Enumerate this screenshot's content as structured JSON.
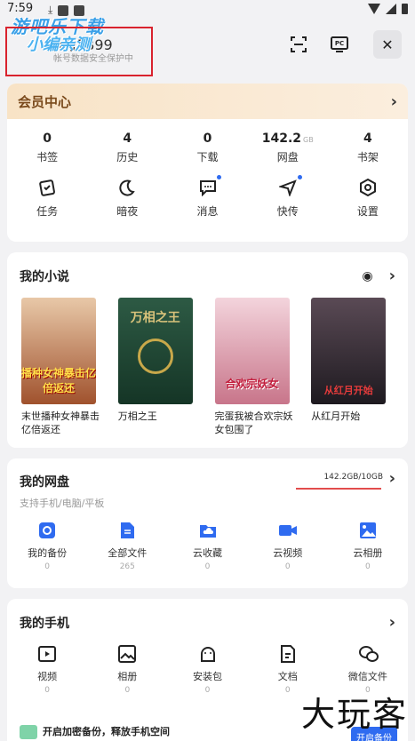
{
  "status": {
    "time": "7:59"
  },
  "header": {
    "watermark_line1": "游吧乐下载",
    "watermark_line2": "小编亲测",
    "username": "华为3899",
    "subtitle": "帐号数据安全保护中",
    "scan_icon": "scan-icon",
    "pc_label": "PC",
    "close_icon": "close-icon"
  },
  "vip": {
    "title": "会员中心",
    "stats": [
      {
        "num": "0",
        "unit": "",
        "label": "书签"
      },
      {
        "num": "4",
        "unit": "",
        "label": "历史"
      },
      {
        "num": "0",
        "unit": "",
        "label": "下载"
      },
      {
        "num": "142.2",
        "unit": "GB",
        "label": "网盘"
      },
      {
        "num": "4",
        "unit": "",
        "label": "书架"
      }
    ],
    "tools": [
      {
        "label": "任务",
        "icon": "task-icon"
      },
      {
        "label": "暗夜",
        "icon": "moon-icon"
      },
      {
        "label": "消息",
        "icon": "message-icon"
      },
      {
        "label": "快传",
        "icon": "send-icon"
      },
      {
        "label": "设置",
        "icon": "settings-icon"
      }
    ]
  },
  "novel": {
    "title": "我的小说",
    "books": [
      {
        "title": "末世播种女神暴击亿倍返还",
        "cover_text": "播种女神暴击亿倍返还",
        "color": "#c98a5a"
      },
      {
        "title": "万相之王",
        "cover_text": "万相之王",
        "color": "#1f4a36"
      },
      {
        "title": "完蛋我被合欢宗妖女包围了",
        "cover_text": "合欢宗妖女",
        "color": "#e7b3bc"
      },
      {
        "title": "从红月开始",
        "cover_text": "从红月开始",
        "color": "#3a2a32"
      }
    ]
  },
  "disk": {
    "title": "我的网盘",
    "subtitle": "支持手机/电脑/平板",
    "quota": "142.2GB/10GB",
    "quota_fraction": 1.0,
    "items": [
      {
        "label": "我的备份",
        "count": "0",
        "icon": "backup-icon"
      },
      {
        "label": "全部文件",
        "count": "265",
        "icon": "file-icon"
      },
      {
        "label": "云收藏",
        "count": "0",
        "icon": "cloud-folder-icon"
      },
      {
        "label": "云视频",
        "count": "0",
        "icon": "video-icon"
      },
      {
        "label": "云相册",
        "count": "0",
        "icon": "album-icon"
      }
    ]
  },
  "phone": {
    "title": "我的手机",
    "items": [
      {
        "label": "视频",
        "count": "0",
        "icon": "play-icon"
      },
      {
        "label": "相册",
        "count": "0",
        "icon": "image-icon"
      },
      {
        "label": "安装包",
        "count": "0",
        "icon": "android-icon"
      },
      {
        "label": "文档",
        "count": "0",
        "icon": "doc-icon"
      },
      {
        "label": "微信文件",
        "count": "0",
        "icon": "wechat-icon"
      }
    ],
    "backup_text": "开启加密备份，释放手机空间",
    "backup_button": "开启备份"
  },
  "corner_watermark": "大玩客",
  "colors": {
    "accent": "#2f6bf0",
    "vip_bg": "#f8e3c6",
    "annotation": "#d9232e"
  }
}
